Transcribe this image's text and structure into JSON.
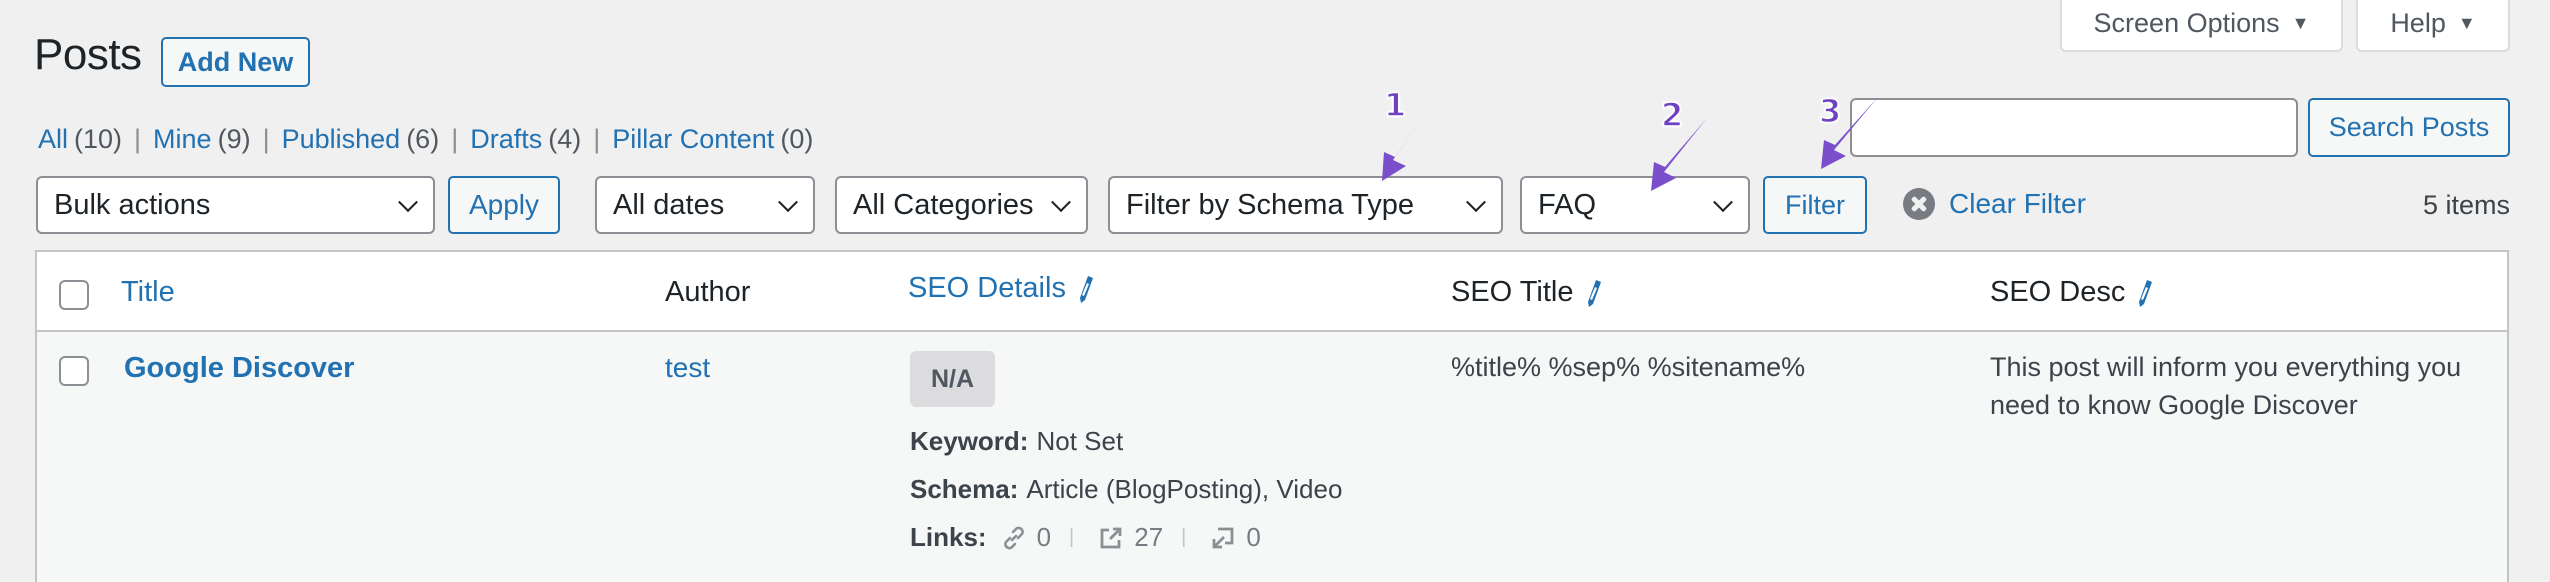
{
  "page": {
    "title": "Posts",
    "add_new_label": "Add New"
  },
  "screen_meta": {
    "screen_options_label": "Screen Options",
    "help_label": "Help",
    "toggle_glyph": "▼"
  },
  "views": [
    {
      "label": "All",
      "count": "(10)"
    },
    {
      "label": "Mine",
      "count": "(9)"
    },
    {
      "label": "Published",
      "count": "(6)"
    },
    {
      "label": "Drafts",
      "count": "(4)"
    },
    {
      "label": "Pillar Content",
      "count": "(0)"
    }
  ],
  "views_separator": "|",
  "search": {
    "value": "",
    "placeholder": "",
    "button_label": "Search Posts"
  },
  "filters": {
    "bulk_actions": "Bulk actions",
    "apply_label": "Apply",
    "dates": "All dates",
    "categories": "All Categories",
    "schema_type": "Filter by Schema Type",
    "schema_value": "FAQ",
    "filter_label": "Filter",
    "clear_filter_label": "Clear Filter",
    "items_count": "5 items"
  },
  "annotations": [
    {
      "number": "1",
      "target": "schema-type-select"
    },
    {
      "number": "2",
      "target": "schema-value-select"
    },
    {
      "number": "3",
      "target": "filter-button"
    }
  ],
  "annotation_color": "#7b4fcc",
  "table": {
    "columns": {
      "title": "Title",
      "author": "Author",
      "seo_details": "SEO Details",
      "seo_title": "SEO Title",
      "seo_desc": "SEO Desc"
    },
    "rows": [
      {
        "title": "Google Discover",
        "author": "test",
        "seo_score": "N/A",
        "keyword_label": "Keyword:",
        "keyword": "Not Set",
        "schema_label": "Schema:",
        "schema": "Article (BlogPosting), Video",
        "links_label": "Links:",
        "internal_links": "0",
        "external_links": "27",
        "incoming_links": "0",
        "seo_title": "%title% %sep% %sitename%",
        "seo_desc": "This post will inform you everything you need to know Google Discover"
      }
    ]
  },
  "colors": {
    "accent": "#2271b1",
    "background": "#f0f0f1",
    "text": "#1d2327",
    "muted": "#50575e",
    "border": "#c3c4c7"
  }
}
